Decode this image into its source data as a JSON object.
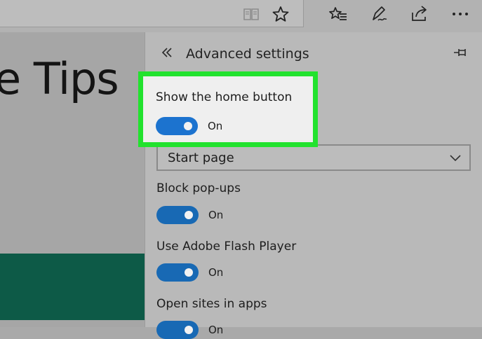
{
  "page": {
    "title_fragment": "e Tips"
  },
  "panel": {
    "title": "Advanced settings",
    "home_button": {
      "label": "Show the home button",
      "state": "On"
    },
    "home_select": {
      "value": "Start page"
    },
    "block_popups": {
      "label": "Block pop-ups",
      "state": "On"
    },
    "flash_player": {
      "label": "Use Adobe Flash Player",
      "state": "On"
    },
    "open_sites": {
      "label": "Open sites in apps",
      "state": "On"
    }
  },
  "colors": {
    "highlight_border": "#22e22e",
    "toggle_on": "#1869b4",
    "green_band": "#0d5a47"
  },
  "icons": [
    "reading-view-icon",
    "favorite-star-icon",
    "favorites-hub-icon",
    "web-note-icon",
    "share-icon",
    "more-icon",
    "back-double-chevron-icon",
    "pin-icon",
    "chevron-down-icon"
  ]
}
